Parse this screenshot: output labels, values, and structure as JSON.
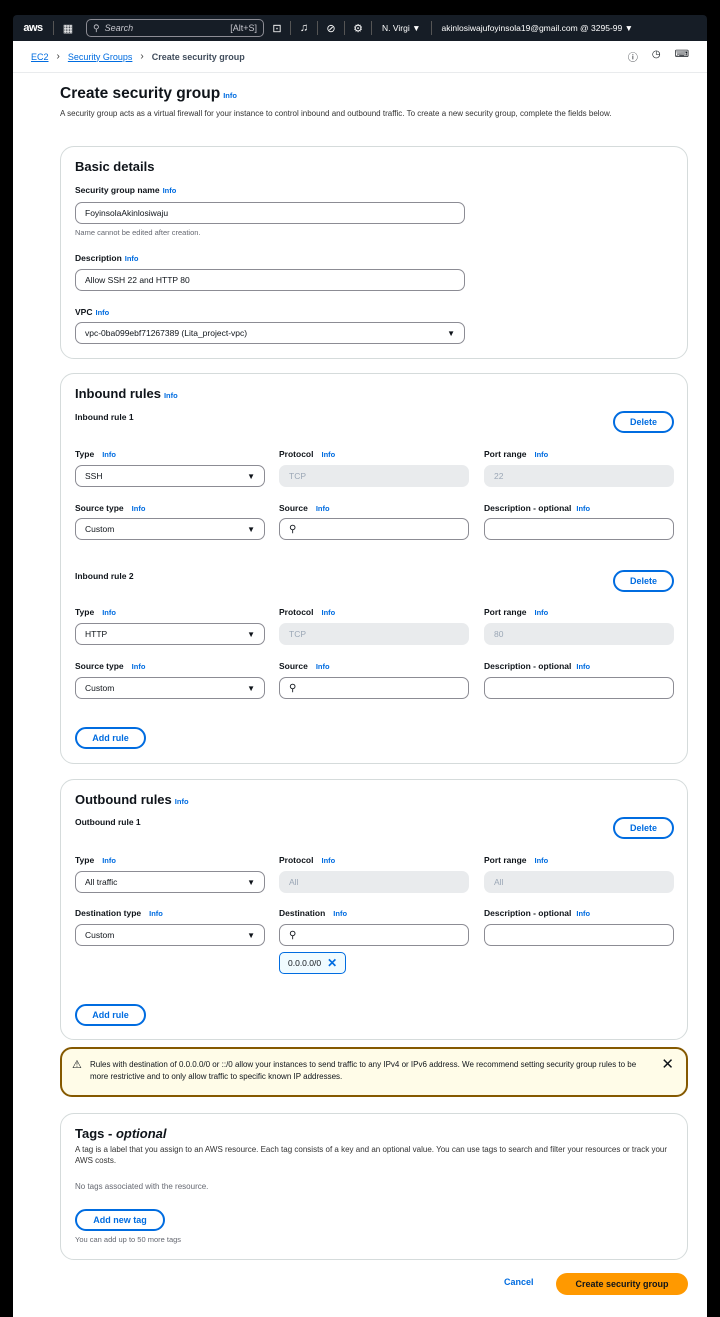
{
  "topnav": {
    "logo": "aws",
    "search_placeholder": "Search",
    "search_shortcut": "[Alt+S]",
    "region": "N. Virgi ▼",
    "account": "akinlosiwajufoyinsola19@gmail.com @ 3295-99 ▼"
  },
  "breadcrumb": {
    "root": "EC2",
    "section": "Security Groups",
    "current": "Create security group"
  },
  "page": {
    "title": "Create security group",
    "info": "Info",
    "intro": "A security group acts as a virtual firewall for your instance to control inbound and outbound traffic. To create a new security group, complete the fields below."
  },
  "basic": {
    "title": "Basic details",
    "name_label": "Security group name",
    "name_value": "FoyinsolaAkinlosiwaju",
    "name_hint": "Name cannot be edited after creation.",
    "desc_label": "Description",
    "desc_value": "Allow SSH 22 and HTTP 80",
    "vpc_label": "VPC",
    "vpc_value": "vpc-0ba099ebf71267389 (Lita_project-vpc)"
  },
  "labels": {
    "type": "Type",
    "protocol": "Protocol",
    "port_range": "Port range",
    "source_type": "Source type",
    "source": "Source",
    "desc_opt": "Description - optional",
    "dest_type": "Destination type",
    "destination": "Destination",
    "delete": "Delete",
    "add_rule": "Add rule",
    "info": "Info"
  },
  "inbound": {
    "title": "Inbound rules",
    "rules": [
      {
        "title": "Inbound rule 1",
        "type": "SSH",
        "protocol": "TCP",
        "port": "22",
        "source_type": "Custom"
      },
      {
        "title": "Inbound rule 2",
        "type": "HTTP",
        "protocol": "TCP",
        "port": "80",
        "source_type": "Custom"
      }
    ]
  },
  "outbound": {
    "title": "Outbound rules",
    "rule": {
      "title": "Outbound rule 1",
      "type": "All traffic",
      "protocol": "All",
      "port": "All",
      "dest_type": "Custom",
      "token": "0.0.0.0/0"
    }
  },
  "warning": {
    "text": "Rules with destination of 0.0.0.0/0 or ::/0 allow your instances to send traffic to any IPv4 or IPv6 address. We recommend setting security group rules to be more restrictive and to only allow traffic to specific known IP addresses."
  },
  "tags": {
    "title": "Tags - ",
    "title_opt": "optional",
    "desc": "A tag is a label that you assign to an AWS resource. Each tag consists of a key and an optional value. You can use tags to search and filter your resources or track your AWS costs.",
    "empty": "No tags associated with the resource.",
    "add": "Add new tag",
    "limit": "You can add up to 50 more tags"
  },
  "footer": {
    "cancel": "Cancel",
    "create": "Create security group"
  }
}
